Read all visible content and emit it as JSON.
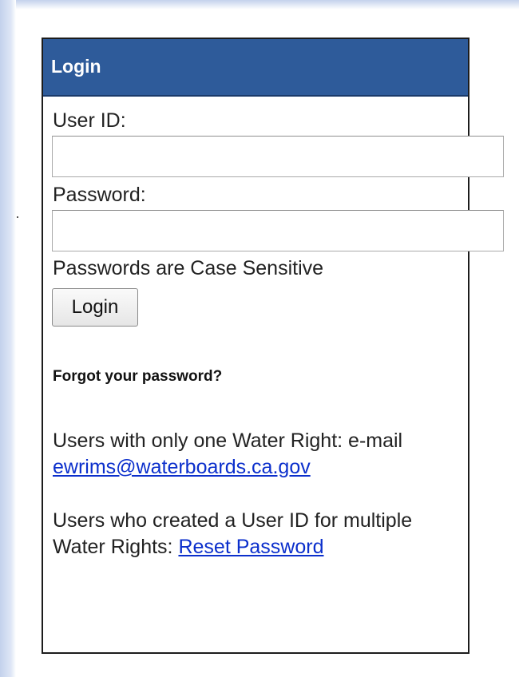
{
  "login_panel": {
    "title": "Login",
    "user_id_label": "User ID:",
    "user_id_value": "",
    "password_label": "Password:",
    "password_value": "",
    "case_note": "Passwords are Case Sensitive",
    "login_button_label": "Login",
    "forgot_heading": "Forgot your password?",
    "single_right_text": "Users with only one Water Right: e-mail",
    "contact_email": "ewrims@waterboards.ca.gov",
    "multi_right_text": "Users who created a User ID for multiple Water Rights:",
    "reset_link_label": "Reset Password"
  },
  "colors": {
    "header_bg": "#2e5b9a",
    "link": "#0b2fcc",
    "backdrop_gradient": "#c3d1ec"
  }
}
